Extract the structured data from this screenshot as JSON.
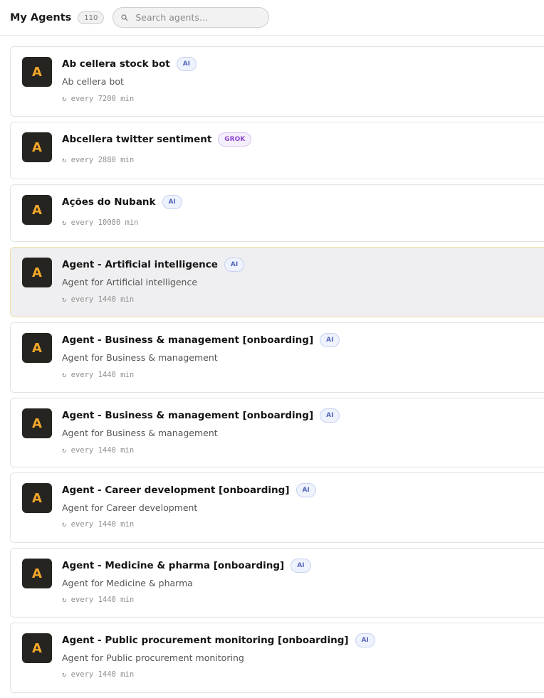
{
  "header": {
    "title": "My Agents",
    "count": "110",
    "search_placeholder": "Search agents…"
  },
  "accent_color": "#f2a72a",
  "agents": [
    {
      "avatar": "A",
      "name": "Ab cellera stock bot",
      "tag": "AI",
      "description": "Ab cellera bot",
      "schedule": "↻ every 7200 min"
    },
    {
      "avatar": "A",
      "name": "Abcellera twitter sentiment",
      "tag": "GROK",
      "description": "",
      "schedule": "↻ every 2880 min"
    },
    {
      "avatar": "A",
      "name": "Ações do Nubank",
      "tag": "AI",
      "description": "",
      "schedule": "↻ every 10080 min"
    },
    {
      "avatar": "A",
      "name": "Agent - Artificial intelligence",
      "tag": "AI",
      "description": "Agent for Artificial intelligence",
      "schedule": "↻ every 1440 min",
      "selected": true
    },
    {
      "avatar": "A",
      "name": "Agent - Business & management [onboarding]",
      "tag": "AI",
      "description": "Agent for Business & management",
      "schedule": "↻ every 1440 min"
    },
    {
      "avatar": "A",
      "name": "Agent - Business & management [onboarding]",
      "tag": "AI",
      "description": "Agent for Business & management",
      "schedule": "↻ every 1440 min"
    },
    {
      "avatar": "A",
      "name": "Agent - Career development [onboarding]",
      "tag": "AI",
      "description": "Agent for Career development",
      "schedule": "↻ every 1440 min"
    },
    {
      "avatar": "A",
      "name": "Agent - Medicine & pharma [onboarding]",
      "tag": "AI",
      "description": "Agent for Medicine & pharma",
      "schedule": "↻ every 1440 min"
    },
    {
      "avatar": "A",
      "name": "Agent - Public procurement monitoring [onboarding]",
      "tag": "AI",
      "description": "Agent for Public procurement monitoring",
      "schedule": "↻ every 1440 min"
    }
  ]
}
